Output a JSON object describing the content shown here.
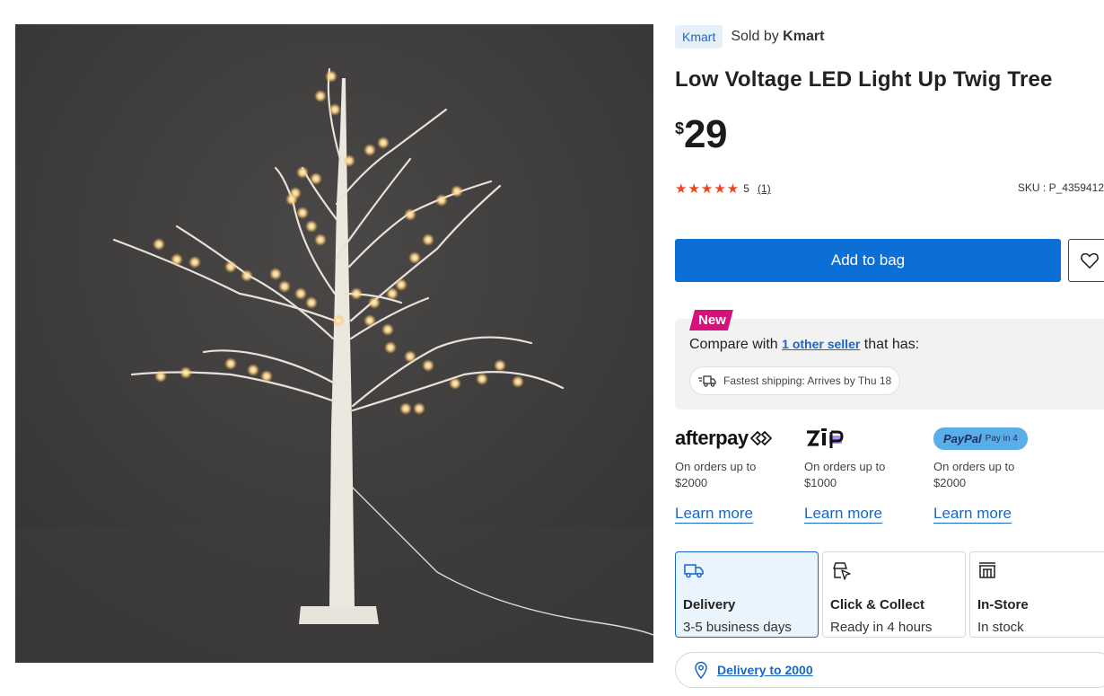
{
  "product": {
    "seller_chip": "Kmart",
    "sold_by_prefix": "Sold by",
    "sold_by_name": "Kmart",
    "title": "Low Voltage LED Light Up Twig Tree",
    "price_currency": "$",
    "price_amount": "29",
    "rating_value": "5",
    "rating_count": "(1)",
    "stars": "★★★★★",
    "sku": "SKU : P_4359412"
  },
  "actions": {
    "add_to_bag": "Add to bag"
  },
  "compare": {
    "badge": "New",
    "text_before": "Compare with",
    "link": "1 other seller",
    "text_after": "that has:",
    "shipping_pill": "Fastest shipping: Arrives by Thu 18"
  },
  "payments": [
    {
      "logo": "afterpay",
      "desc_line1": "On orders up to",
      "desc_line2": "$2000",
      "link": "Learn more"
    },
    {
      "logo": "zip",
      "desc_line1": "On orders up to",
      "desc_line2": "$1000",
      "link": "Learn more"
    },
    {
      "logo": "PayPal",
      "logo_sub": "Pay in 4",
      "desc_line1": "On orders up to",
      "desc_line2": "$2000",
      "link": "Learn more"
    }
  ],
  "fulfilment": [
    {
      "name": "Delivery",
      "sub": "3-5 business days",
      "icon": "truck-icon",
      "selected": true
    },
    {
      "name": "Click & Collect",
      "sub": "Ready in 4 hours",
      "icon": "click-collect-icon",
      "selected": false
    },
    {
      "name": "In-Store",
      "sub": "In stock",
      "icon": "store-icon",
      "selected": false
    }
  ],
  "delivery_location": "Delivery to 2000",
  "colors": {
    "primary_blue": "#0b6fd6",
    "link_blue": "#1967c6",
    "star_orange": "#e8481f",
    "new_badge": "#d6127a",
    "photo_bg": "#444242"
  }
}
